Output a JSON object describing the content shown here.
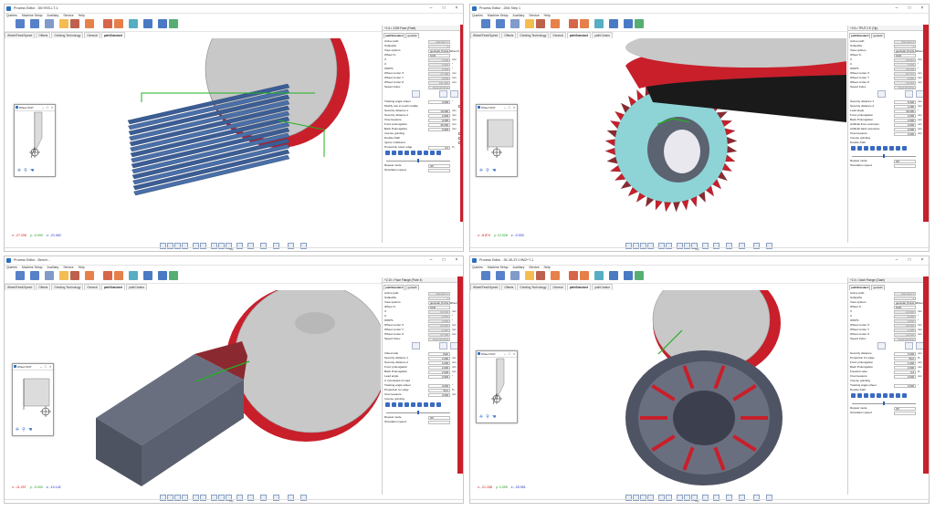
{
  "windows": [
    {
      "title": "Process Editor - 3M HSS-I-T-1",
      "menu": [
        "Queries",
        "Machine Setup",
        "Auxiliary",
        "Service",
        "Help"
      ],
      "tabs": [
        "Wheel/Feed/Speed",
        "Offsets",
        "Grinding Technology",
        "General",
        "pathStandard"
      ],
      "active_tab": "pathStandard",
      "panel_title": "+1.6 • 1249 Face (Flute)",
      "panel_tabs": [
        "pathStandard",
        "geoEdit"
      ],
      "rows": [
        {
          "label": "Active path",
          "value": "Standard 1",
          "gray": true
        },
        {
          "label": "Subpaths",
          "value": "1",
          "gray": true
        },
        {
          "label": "View options",
          "value": "geoAxial, Points, Wheel S...",
          "drop": true
        },
        {
          "label": "Wheel S..",
          "value": "SCR",
          "drop": true
        },
        {
          "label": "X",
          "value": "0.000",
          "unit": "mm",
          "gray": true
        },
        {
          "label": "C",
          "value": "0.000",
          "unit": "°",
          "gray": true
        },
        {
          "label": "WOPS",
          "value": "0.000",
          "unit": "°",
          "gray": true
        },
        {
          "label": "Wheel center X",
          "value": "-17.298",
          "unit": "mm",
          "gray": true
        },
        {
          "label": "Wheel center Y",
          "value": "0.000",
          "unit": "mm",
          "gray": true
        },
        {
          "label": "Wheel center Z",
          "value": "121.993",
          "unit": "mm",
          "gray": true
        },
        {
          "label": "Speed Index",
          "value": "Feed grinding",
          "gray": true
        }
      ],
      "rows2": [
        {
          "label": "Twisting angle wheel",
          "value": "0.000",
          "unit": "°"
        },
        {
          "label": "Modify tool to touch middle",
          "check": true
        },
        {
          "label": "Security distance 1",
          "value": "10.000",
          "unit": "mm"
        },
        {
          "label": "Security distance 2",
          "value": "2.000",
          "unit": "mm"
        },
        {
          "label": "Overmeasure",
          "value": "0.000",
          "unit": "mm"
        },
        {
          "label": "Front prolongation",
          "value": "25.000",
          "unit": "mm"
        },
        {
          "label": "Back Prolongation",
          "value": "0.000",
          "unit": "mm"
        },
        {
          "label": "Inverse grinding",
          "check": true
        },
        {
          "label": "Double Path",
          "check": true
        },
        {
          "label": "Ignore Collisions",
          "check": true
        },
        {
          "label": "Proportion lower edge",
          "value": "0.0",
          "unit": "%"
        }
      ],
      "repeat_mode_label": "Repeat mode",
      "repeat_mode_value": "Off",
      "sim_speed_label": "Simulation speed",
      "coords": {
        "x": "x: -27.206",
        "y": "y: -0.000",
        "z": "z: -21.062"
      },
      "status": "Ogl",
      "wheel_win_title": "Wheel SCP"
    },
    {
      "title": "Process Editor - 2M4 Step 1",
      "menu": [
        "Queries",
        "Machine Setup",
        "Auxiliary",
        "Service",
        "Help"
      ],
      "tabs": [
        "Wheel/Feed/Speed",
        "Offsets",
        "Grinding Technology",
        "General",
        "pathStandard",
        "pathCreator"
      ],
      "active_tab": "pathStandard",
      "panel_title": "+2.6 • TPUT 2 E (Tip)",
      "panel_tabs": [
        "pathStandard",
        "geoEdit"
      ],
      "rows": [
        {
          "label": "Active path",
          "value": "Standard 2",
          "gray": true
        },
        {
          "label": "Subpaths",
          "value": "1",
          "gray": true
        },
        {
          "label": "View options",
          "value": "geoAxial, Points, Wheel S...",
          "drop": true
        },
        {
          "label": "Wheel S..",
          "value": "SCR",
          "drop": true
        },
        {
          "label": "X",
          "value": "-39.513",
          "unit": "mm",
          "gray": true
        },
        {
          "label": "C",
          "value": "0.000",
          "unit": "°",
          "gray": true
        },
        {
          "label": "WOPS",
          "value": "90.000",
          "unit": "°",
          "gray": true
        },
        {
          "label": "Wheel center X",
          "value": "-51.573",
          "unit": "mm",
          "gray": true
        },
        {
          "label": "Wheel center Y",
          "value": "-0.000",
          "unit": "mm",
          "gray": true
        },
        {
          "label": "Wheel center Z",
          "value": "-15.503",
          "unit": "mm",
          "gray": true
        },
        {
          "label": "Speed Index",
          "value": "Feed grinding",
          "gray": true
        }
      ],
      "rows2": [
        {
          "label": "Security distance 1",
          "value": "5.000",
          "unit": "mm"
        },
        {
          "label": "Security distance 2",
          "value": "1.000",
          "unit": "mm"
        },
        {
          "label": "Lead angle",
          "value": "90.000",
          "unit": "°"
        },
        {
          "label": "Front prolongation",
          "value": "2.000",
          "unit": "mm"
        },
        {
          "label": "Back Prolongation",
          "value": "2.000",
          "unit": "mm"
        },
        {
          "label": "Artificial front extension",
          "value": "0.000",
          "unit": "mm"
        },
        {
          "label": "Artificial back extension",
          "value": "0.000",
          "unit": "mm"
        },
        {
          "label": "Overmeasure",
          "value": "0.000",
          "unit": "mm"
        },
        {
          "label": "Inverse grinding",
          "check": true
        },
        {
          "label": "Double Path",
          "check": true
        }
      ],
      "repeat_mode_label": "Repeat mode",
      "repeat_mode_value": "Off",
      "sim_speed_label": "Simulation speed",
      "coords": {
        "x": "x: -8.874",
        "y": "y: 12.028",
        "z": "z: -0.000"
      },
      "status": "Ogl",
      "wheel_win_title": "Wheel SCP"
    },
    {
      "title": "Process Editor - Bench...",
      "menu": [
        "Queries",
        "Machine Setup",
        "Auxiliary",
        "Service",
        "Help"
      ],
      "tabs": [
        "Wheel/Feed/Speed",
        "Offsets",
        "Grinding Technology",
        "General",
        "pathStandard",
        "pathCreator"
      ],
      "active_tab": "pathStandard",
      "panel_title": "+2.10 • Face Flange (Flute 4)",
      "panel_tabs": [
        "pathStandard",
        "geoEdit"
      ],
      "rows": [
        {
          "label": "Active path",
          "value": "Standard 1",
          "gray": true
        },
        {
          "label": "Subpaths",
          "value": "1",
          "gray": true
        },
        {
          "label": "View options",
          "value": "geoAxial, Points, Wheel S...",
          "drop": true
        },
        {
          "label": "Wheel S..",
          "value": "SCR",
          "drop": true
        },
        {
          "label": "X",
          "value": "-90.000",
          "unit": "mm",
          "gray": true
        },
        {
          "label": "C",
          "value": "-1.870",
          "unit": "°",
          "gray": true
        },
        {
          "label": "WOPS",
          "value": "0.000",
          "unit": "°",
          "gray": true
        },
        {
          "label": "Wheel center X",
          "value": "-93.026",
          "unit": "mm",
          "gray": true
        },
        {
          "label": "Wheel center Y",
          "value": "-0.210",
          "unit": "mm",
          "gray": true
        },
        {
          "label": "Wheel center Z",
          "value": "-37.008",
          "unit": "mm",
          "gray": true
        },
        {
          "label": "Speed Index",
          "value": "Feed grinding",
          "gray": true
        }
      ],
      "rows2": [
        {
          "label": "Infeed side",
          "value": "Path"
        },
        {
          "label": "Security distance 1",
          "value": "2.000",
          "unit": "mm"
        },
        {
          "label": "Security distance 2",
          "value": "2.000",
          "unit": "mm"
        },
        {
          "label": "Front prolongation",
          "value": "2.000",
          "unit": "mm"
        },
        {
          "label": "Back Prolongation",
          "value": "2.000",
          "unit": "mm"
        },
        {
          "label": "Lead angle",
          "value": "0.000",
          "unit": "°"
        },
        {
          "label": "C in/outward of road",
          "check": true
        },
        {
          "label": "Twisting angle wheel",
          "value": "0.000",
          "unit": "°"
        },
        {
          "label": "Proportion for edge",
          "value": "50.0",
          "unit": "%"
        },
        {
          "label": "Overmeasure",
          "value": "0.000",
          "unit": "mm"
        },
        {
          "label": "Inverse grinding",
          "check": true
        }
      ],
      "repeat_mode_label": "Repeat mode",
      "repeat_mode_value": "Off",
      "sim_speed_label": "Simulation speed",
      "coords": {
        "x": "x: -11.297",
        "y": "y: -0.000",
        "z": "z: -10.142"
      },
      "status": "Ogl",
      "wheel_win_title": "Wheel SCP"
    },
    {
      "title": "Process Editor - 3K-35-ZYJ-9M2+T-1",
      "menu": [
        "Queries",
        "Machine Setup",
        "Auxiliary",
        "Service",
        "Help"
      ],
      "tabs": [
        "Wheel/Feed/Speed",
        "Offsets",
        "Grinding Technology",
        "General",
        "pathStandard",
        "pathCreator"
      ],
      "active_tab": "pathStandard",
      "panel_title": "+2.4 • Gash Flange (Gash)",
      "panel_tabs": [
        "pathStandard",
        "geoEdit"
      ],
      "rows": [
        {
          "label": "Active path",
          "value": "Standard 1",
          "gray": true
        },
        {
          "label": "Subpaths",
          "value": "1",
          "gray": true
        },
        {
          "label": "View options",
          "value": "geoAxial, Points, Wheel S...",
          "drop": true
        },
        {
          "label": "Wheel S..",
          "value": "SCR",
          "drop": true
        },
        {
          "label": "X",
          "value": "-20.000",
          "unit": "mm",
          "gray": true
        },
        {
          "label": "C",
          "value": "-8.000",
          "unit": "°",
          "gray": true
        },
        {
          "label": "WOPS",
          "value": "0.000",
          "unit": "°",
          "gray": true
        },
        {
          "label": "Wheel center X",
          "value": "-30.000",
          "unit": "mm",
          "gray": true
        },
        {
          "label": "Wheel center Y",
          "value": "-3.435",
          "unit": "mm",
          "gray": true
        },
        {
          "label": "Wheel center Z",
          "value": "-12.002",
          "unit": "mm",
          "gray": true
        },
        {
          "label": "Speed Index",
          "value": "Feed grinding",
          "gray": true
        }
      ],
      "rows2": [
        {
          "label": "Security distance",
          "value": "5.000",
          "unit": "mm"
        },
        {
          "label": "Proportion for edge",
          "value": "50.0",
          "unit": "%"
        },
        {
          "label": "Front prolongation",
          "value": "1.000",
          "unit": "mm"
        },
        {
          "label": "Back Prolongation",
          "value": "2.000",
          "unit": "mm"
        },
        {
          "label": "Freedom also",
          "value": "0.0",
          "unit": "%"
        },
        {
          "label": "Overmeasure",
          "value": "0.000",
          "unit": "mm"
        },
        {
          "label": "Inverse grinding",
          "check": true
        },
        {
          "label": "Twisting angle wheel",
          "value": "0.000",
          "unit": "°"
        },
        {
          "label": "Double Path",
          "check": true
        }
      ],
      "repeat_mode_label": "Repeat mode",
      "repeat_mode_value": "Off",
      "sim_speed_label": "Simulation speed",
      "coords": {
        "x": "x: -21.158",
        "y": "y: 4.399",
        "z": "z: -25.951"
      },
      "status": "Ogl",
      "wheel_win_title": "Wheel SCP"
    }
  ],
  "colors": {
    "wheel_red": "#c81f2b",
    "wheel_gray": "#c8c8c8",
    "tool_blue": "#4a6fa8",
    "tool_dark": "#5a6070",
    "path_green": "#22b022",
    "accent_blue": "#2a63b8"
  }
}
